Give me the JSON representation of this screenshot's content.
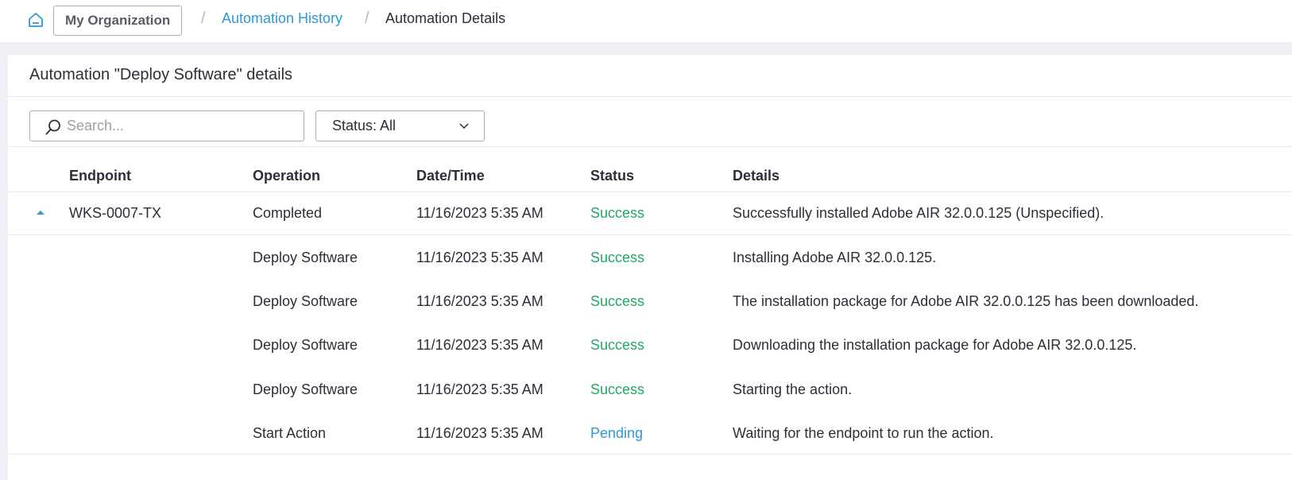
{
  "breadcrumb": {
    "org": "My Organization",
    "history": "Automation History",
    "current": "Automation Details",
    "separator": "/"
  },
  "panel": {
    "title": "Automation \"Deploy Software\" details"
  },
  "search": {
    "placeholder": "Search..."
  },
  "status_filter": {
    "label": "Status: All"
  },
  "table": {
    "headers": {
      "endpoint": "Endpoint",
      "operation": "Operation",
      "datetime": "Date/Time",
      "status": "Status",
      "details": "Details"
    },
    "rows": [
      {
        "endpoint": "WKS-0007-TX",
        "operation": "Completed",
        "datetime": "11/16/2023 5:35 AM",
        "status": "Success",
        "details": "Successfully installed Adobe AIR 32.0.0.125 (Unspecified)."
      },
      {
        "endpoint": "",
        "operation": "Deploy Software",
        "datetime": "11/16/2023 5:35 AM",
        "status": "Success",
        "details": "Installing Adobe AIR 32.0.0.125."
      },
      {
        "endpoint": "",
        "operation": "Deploy Software",
        "datetime": "11/16/2023 5:35 AM",
        "status": "Success",
        "details": "The installation package for Adobe AIR 32.0.0.125 has been downloaded."
      },
      {
        "endpoint": "",
        "operation": "Deploy Software",
        "datetime": "11/16/2023 5:35 AM",
        "status": "Success",
        "details": "Downloading the installation package for Adobe AIR 32.0.0.125."
      },
      {
        "endpoint": "",
        "operation": "Deploy Software",
        "datetime": "11/16/2023 5:35 AM",
        "status": "Success",
        "details": "Starting the action."
      },
      {
        "endpoint": "",
        "operation": "Start Action",
        "datetime": "11/16/2023 5:35 AM",
        "status": "Pending",
        "details": "Waiting for the endpoint to run the action."
      }
    ]
  },
  "colors": {
    "accent": "#2d9ad6",
    "success": "#22a866",
    "pending": "#2d9ad6",
    "background": "#eef0f5"
  },
  "icons": {
    "home": "home-icon",
    "search": "search-icon",
    "dropdown": "chevron-down-icon",
    "expand": "caret-up-icon"
  }
}
